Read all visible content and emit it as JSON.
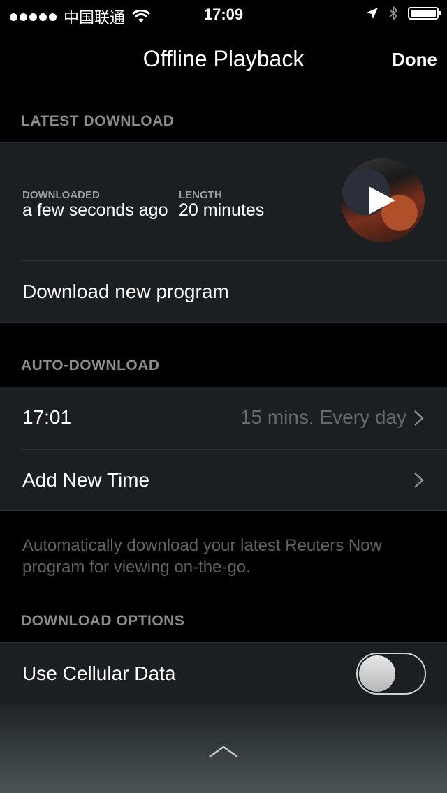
{
  "status_bar": {
    "carrier": "中国联通",
    "time": "17:09"
  },
  "nav": {
    "title": "Offline Playback",
    "done_label": "Done"
  },
  "latest_download": {
    "header": "LATEST DOWNLOAD",
    "downloaded_label": "DOWNLOADED",
    "downloaded_value": "a few seconds ago",
    "length_label": "LENGTH",
    "length_value": "20 minutes",
    "download_new_label": "Download new program"
  },
  "auto_download": {
    "header": "AUTO-DOWNLOAD",
    "schedule_time": "17:01",
    "schedule_detail": "15 mins. Every day",
    "add_time_label": "Add New Time",
    "note": "Automatically download your latest Reuters Now program for viewing on-the-go."
  },
  "download_options": {
    "header": "DOWNLOAD OPTIONS",
    "cellular_label": "Use Cellular Data",
    "cellular_enabled": false
  },
  "icons": [
    "wifi-icon",
    "location-arrow-icon",
    "bluetooth-icon",
    "battery-icon",
    "play-icon",
    "chevron-right-icon",
    "chevron-up-icon"
  ]
}
